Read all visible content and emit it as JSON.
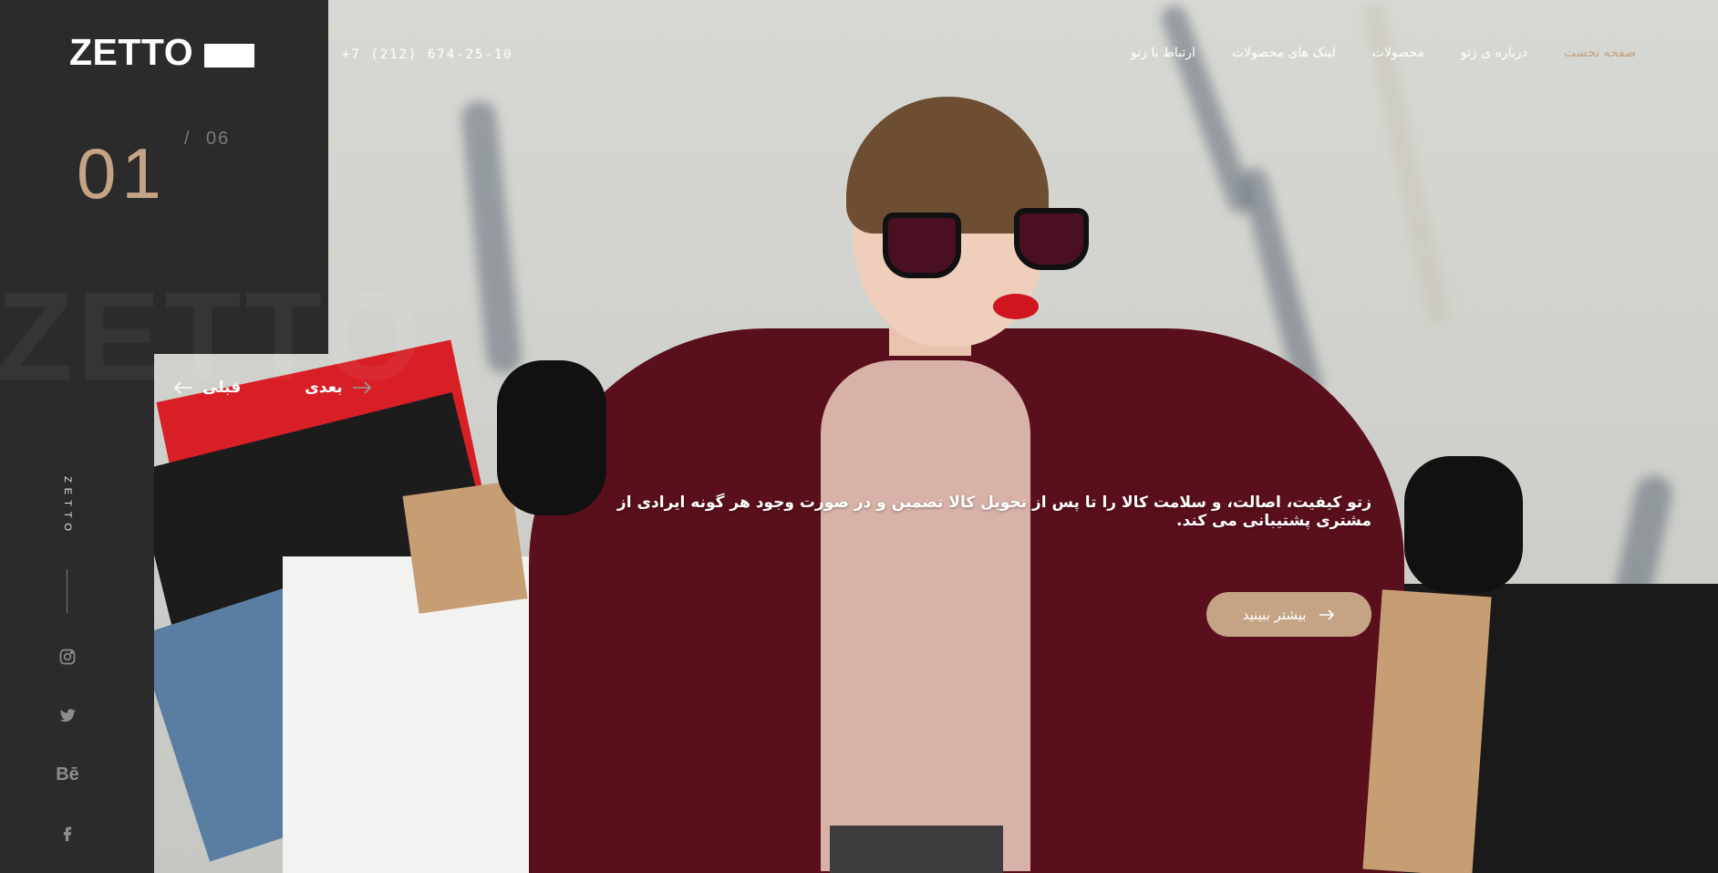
{
  "brand": {
    "logo_text": "ZETTO",
    "watermark": "ZETTO",
    "vertical_text": "ZETTO"
  },
  "header": {
    "phone": "+7 (212) 674-25-10",
    "nav": [
      {
        "label": "صفحه نخست",
        "active": true
      },
      {
        "label": "درباره ی زتو",
        "active": false
      },
      {
        "label": "محصولات",
        "active": false
      },
      {
        "label": "لینک های محصولات",
        "active": false
      },
      {
        "label": "ارتباط با زتو",
        "active": false
      }
    ]
  },
  "slider": {
    "current": "01",
    "separator": "/",
    "total": "06",
    "prev_label": "قبلی",
    "next_label": "بعدی"
  },
  "hero": {
    "tagline": "زتو کیفیت، اصالت، و سلامت کالا را تا پس از تحویل کالا تضمین و در صورت وجود هر گونه ایرادی از مشتری پشتیبانی می کند.",
    "cta_label": "بیشتر ببینید"
  },
  "social": [
    "instagram-icon",
    "twitter-icon",
    "behance-icon",
    "facebook-icon"
  ],
  "colors": {
    "accent": "#c4a484",
    "panel": "#2b2b2b",
    "coat": "#5a0f1c"
  }
}
